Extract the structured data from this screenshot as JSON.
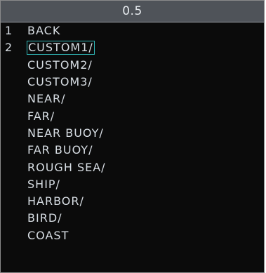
{
  "header": {
    "title": "0.5"
  },
  "menu": {
    "row1": {
      "number": "1",
      "label": "BACK"
    },
    "row2": {
      "number": "2"
    },
    "options": [
      "CUSTOM1/",
      "CUSTOM2/",
      "CUSTOM3/",
      "NEAR/",
      "FAR/",
      "NEAR BUOY/",
      "FAR BUOY/",
      "ROUGH SEA/",
      "SHIP/",
      "HARBOR/",
      "BIRD/",
      "COAST"
    ],
    "selected_index": 0
  },
  "colors": {
    "background": "#0b0b0b",
    "header_bg": "#4f5359",
    "text": "#d7dde3",
    "selection_border": "#2fb4b4"
  }
}
